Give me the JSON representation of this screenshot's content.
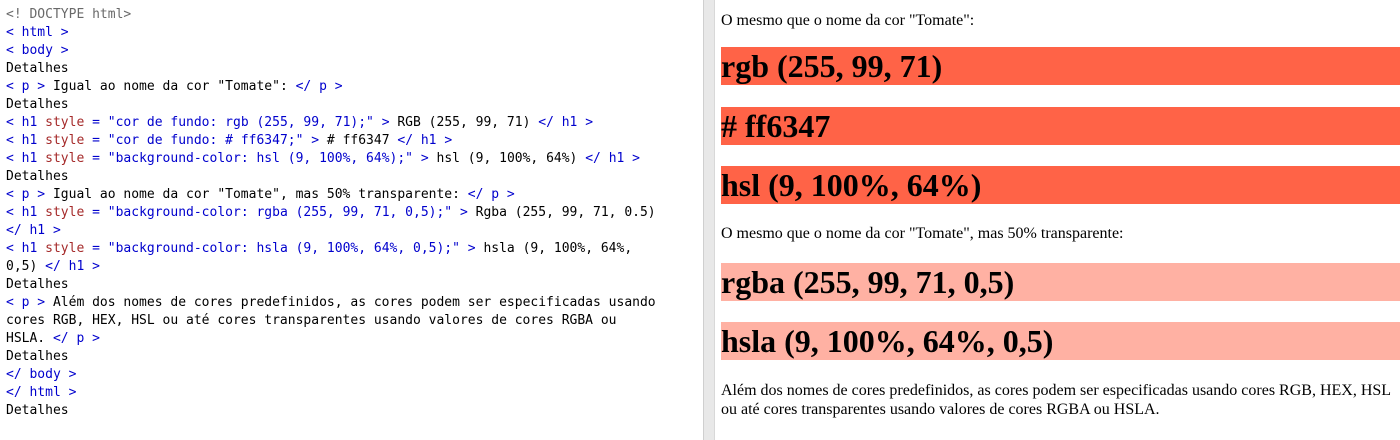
{
  "editor": {
    "lines": [
      [
        {
          "c": "doc",
          "t": "<! DOCTYPE html>"
        }
      ],
      [
        {
          "c": "tag",
          "t": "< html >"
        }
      ],
      [
        {
          "c": "tag",
          "t": "< body >"
        }
      ],
      [
        {
          "c": "txt",
          "t": "Detalhes"
        }
      ],
      [
        {
          "c": "tag",
          "t": "< p >"
        },
        {
          "c": "txt",
          "t": " Igual ao nome da cor \"Tomate\": "
        },
        {
          "c": "tag",
          "t": "</ p >"
        }
      ],
      [
        {
          "c": "txt",
          "t": "Detalhes"
        }
      ],
      [
        {
          "c": "tag",
          "t": "< h1 "
        },
        {
          "c": "attr",
          "t": "style"
        },
        {
          "c": "tag",
          "t": " = "
        },
        {
          "c": "str",
          "t": "\"cor de fundo: rgb (255, 99, 71);\""
        },
        {
          "c": "tag",
          "t": " >"
        },
        {
          "c": "txt",
          "t": " RGB (255, 99, 71) "
        },
        {
          "c": "tag",
          "t": "</ h1 >"
        }
      ],
      [
        {
          "c": "tag",
          "t": "< h1 "
        },
        {
          "c": "attr",
          "t": "style"
        },
        {
          "c": "tag",
          "t": " = "
        },
        {
          "c": "str",
          "t": "\"cor de fundo: # ff6347;\""
        },
        {
          "c": "tag",
          "t": " >"
        },
        {
          "c": "txt",
          "t": " # ff6347 "
        },
        {
          "c": "tag",
          "t": "</ h1 >"
        }
      ],
      [
        {
          "c": "tag",
          "t": "< h1 "
        },
        {
          "c": "attr",
          "t": "style"
        },
        {
          "c": "tag",
          "t": " = "
        },
        {
          "c": "str",
          "t": "\"background-color: hsl (9, 100%, 64%);\""
        },
        {
          "c": "tag",
          "t": " >"
        },
        {
          "c": "txt",
          "t": " hsl (9, 100%, 64%) "
        },
        {
          "c": "tag",
          "t": "</ h1 >"
        }
      ],
      [
        {
          "c": "txt",
          "t": "Detalhes"
        }
      ],
      [
        {
          "c": "tag",
          "t": "< p >"
        },
        {
          "c": "txt",
          "t": " Igual ao nome da cor \"Tomate\", mas 50% transparente: "
        },
        {
          "c": "tag",
          "t": "</ p >"
        }
      ],
      [
        {
          "c": "tag",
          "t": "< h1 "
        },
        {
          "c": "attr",
          "t": "style"
        },
        {
          "c": "tag",
          "t": " = "
        },
        {
          "c": "str",
          "t": "\"background-color: rgba (255, 99, 71, 0,5);\""
        },
        {
          "c": "tag",
          "t": " >"
        },
        {
          "c": "txt",
          "t": " Rgba (255, 99, 71, 0.5)"
        }
      ],
      [
        {
          "c": "tag",
          "t": "</ h1 >"
        }
      ],
      [
        {
          "c": "tag",
          "t": "< h1 "
        },
        {
          "c": "attr",
          "t": "style"
        },
        {
          "c": "tag",
          "t": " = "
        },
        {
          "c": "str",
          "t": "\"background-color: hsla (9, 100%, 64%, 0,5);\""
        },
        {
          "c": "tag",
          "t": " >"
        },
        {
          "c": "txt",
          "t": " hsla (9, 100%, 64%,"
        }
      ],
      [
        {
          "c": "txt",
          "t": "0,5) "
        },
        {
          "c": "tag",
          "t": "</ h1 >"
        }
      ],
      [
        {
          "c": "txt",
          "t": "Detalhes"
        }
      ],
      [
        {
          "c": "tag",
          "t": "< p >"
        },
        {
          "c": "txt",
          "t": " Além dos nomes de cores predefinidos, as cores podem ser especificadas usando"
        }
      ],
      [
        {
          "c": "txt",
          "t": "cores RGB, HEX, HSL ou até cores transparentes usando valores de cores RGBA ou"
        }
      ],
      [
        {
          "c": "txt",
          "t": "HSLA. "
        },
        {
          "c": "tag",
          "t": "</ p >"
        }
      ],
      [
        {
          "c": "txt",
          "t": "Detalhes"
        }
      ],
      [
        {
          "c": "tag",
          "t": "</ body >"
        }
      ],
      [
        {
          "c": "tag",
          "t": "</ html >"
        }
      ],
      [
        {
          "c": "txt",
          "t": "Detalhes"
        }
      ]
    ]
  },
  "result": {
    "p1": "O mesmo que o nome da cor \"Tomate\":",
    "h_rgb": "rgb (255, 99, 71)",
    "h_hex": "# ff6347",
    "h_hsl": "hsl (9, 100%, 64%)",
    "p2": "O mesmo que o nome da cor \"Tomate\", mas 50% transparente:",
    "h_rgba": "rgba (255, 99, 71, 0,5)",
    "h_hsla": "hsla (9, 100%, 64%, 0,5)",
    "p3": "Além dos nomes de cores predefinidos, as cores podem ser especificadas usando cores RGB, HEX, HSL ou até cores transparentes usando valores de cores RGBA ou HSLA.",
    "colors": {
      "tomato": "#ff6347",
      "tomato_half": "#ffb1a3"
    }
  }
}
